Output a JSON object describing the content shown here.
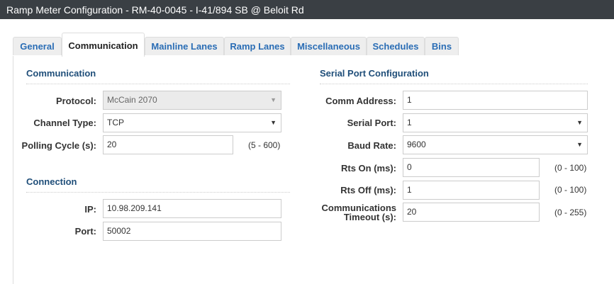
{
  "window": {
    "title": "Ramp Meter Configuration - RM-40-0045 - I-41/894 SB @ Beloit Rd"
  },
  "tabs": [
    "General",
    "Communication",
    "Mainline Lanes",
    "Ramp Lanes",
    "Miscellaneous",
    "Schedules",
    "Bins"
  ],
  "active_tab": "Communication",
  "communication": {
    "heading": "Communication",
    "protocol": {
      "label": "Protocol:",
      "value": "McCain 2070"
    },
    "channel_type": {
      "label": "Channel Type:",
      "value": "TCP"
    },
    "polling_cycle": {
      "label": "Polling Cycle (s):",
      "value": "20",
      "range": "(5 - 600)"
    }
  },
  "connection": {
    "heading": "Connection",
    "ip": {
      "label": "IP:",
      "value": "10.98.209.141"
    },
    "port": {
      "label": "Port:",
      "value": "50002"
    }
  },
  "serial": {
    "heading": "Serial Port Configuration",
    "comm_address": {
      "label": "Comm Address:",
      "value": "1"
    },
    "serial_port": {
      "label": "Serial Port:",
      "value": "1"
    },
    "baud_rate": {
      "label": "Baud Rate:",
      "value": "9600"
    },
    "rts_on": {
      "label": "Rts On (ms):",
      "value": "0",
      "range": "(0 - 100)"
    },
    "rts_off": {
      "label": "Rts Off (ms):",
      "value": "1",
      "range": "(0 - 100)"
    },
    "comm_timeout": {
      "label_line1": "Communications",
      "label_line2": "Timeout (s):",
      "value": "20",
      "range": "(0 - 255)"
    }
  },
  "icons": {
    "dropdown": "▼"
  }
}
